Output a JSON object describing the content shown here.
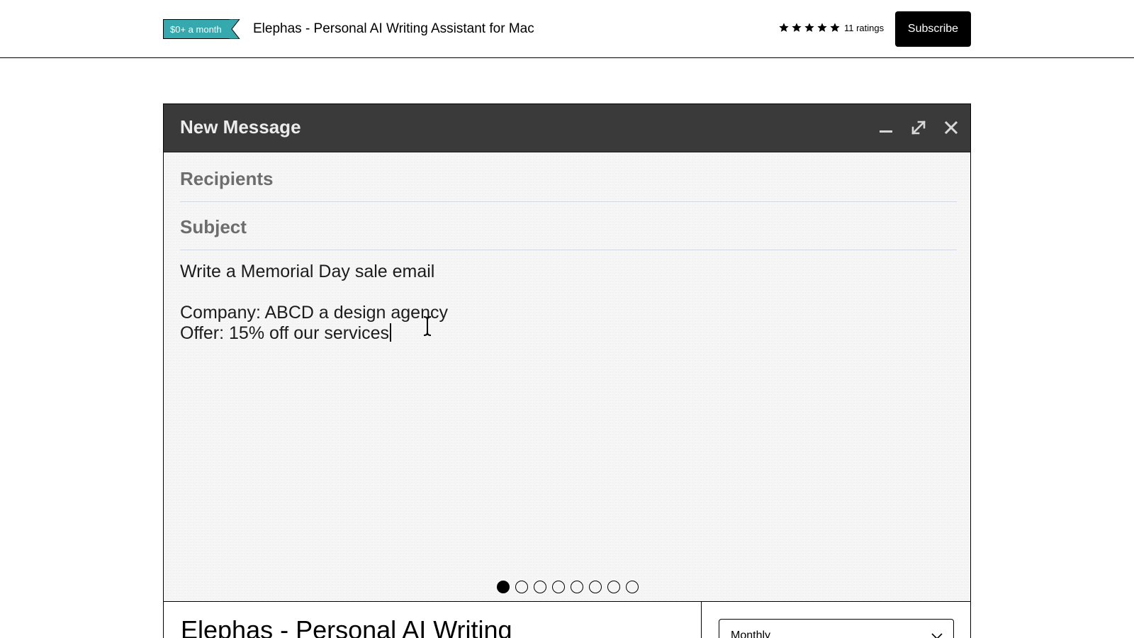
{
  "header": {
    "price_tag": "$0+ a month",
    "product_title": "Elephas - Personal AI Writing Assistant for Mac",
    "rating_stars": 5,
    "ratings_text": "11 ratings",
    "subscribe_label": "Subscribe"
  },
  "compose": {
    "title": "New Message",
    "recipients_placeholder": "Recipients",
    "subject_placeholder": "Subject",
    "body_lines": [
      "Write a Memorial Day sale email",
      "",
      "Company: ABCD a design agency",
      "Offer: 15% off our services"
    ],
    "window_controls": [
      "minimize-icon",
      "expand-icon",
      "close-icon"
    ]
  },
  "carousel": {
    "total_slides": 8,
    "active_index": 0
  },
  "details": {
    "title": "Elephas - Personal AI Writing",
    "plan_selected": "Monthly"
  },
  "colors": {
    "accent": "#36a9ae",
    "compose_header": "#3a3a3a",
    "button": "#000000"
  }
}
